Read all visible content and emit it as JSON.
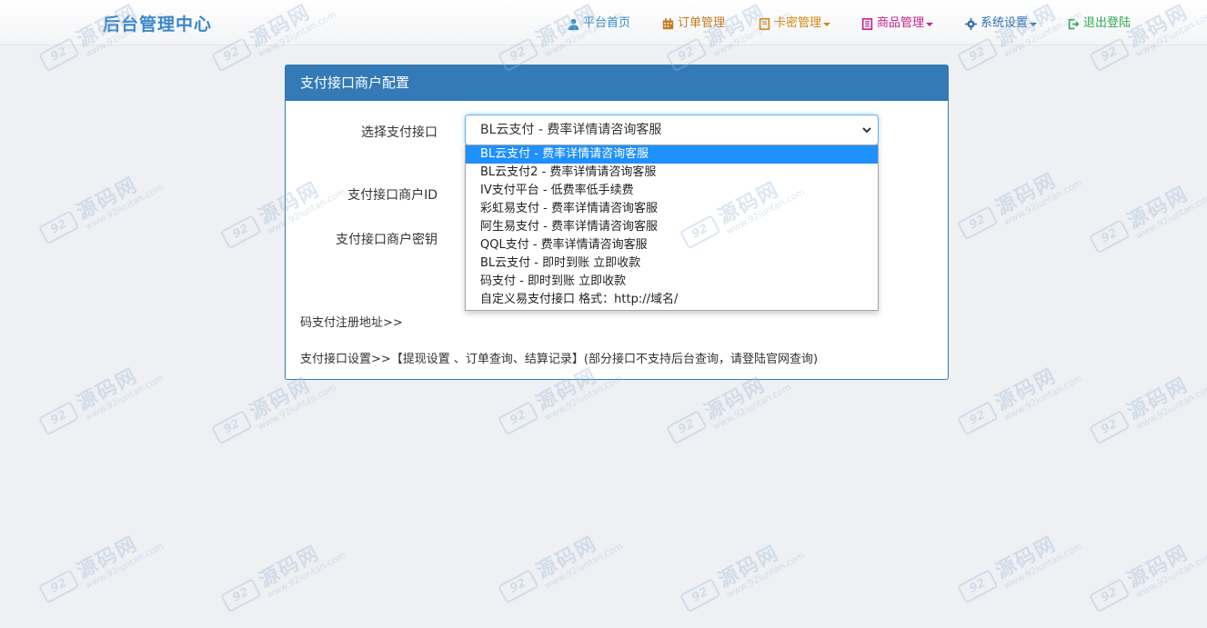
{
  "header": {
    "brand": "后台管理中心",
    "nav": [
      {
        "label": "平台首页",
        "icon": "user-icon",
        "color": "#2f8bc9",
        "dropdown": false
      },
      {
        "label": "订单管理",
        "icon": "calendar-icon",
        "color": "#c57a1f",
        "dropdown": false
      },
      {
        "label": "卡密管理",
        "icon": "book-icon",
        "color": "#d58512",
        "dropdown": true
      },
      {
        "label": "商品管理",
        "icon": "list-icon",
        "color": "#c7218f",
        "dropdown": true
      },
      {
        "label": "系统设置",
        "icon": "gear-icon",
        "color": "#2c6fae",
        "dropdown": true
      },
      {
        "label": "退出登陆",
        "icon": "logout-icon",
        "color": "#35a855",
        "dropdown": false
      }
    ]
  },
  "panel": {
    "title": "支付接口商户配置",
    "select_label": "选择支付接口",
    "selected_value": "BL云支付 - 费率详情请咨询客服",
    "merchant_id_label": "支付接口商户ID",
    "merchant_key_label": "支付接口商户密钥",
    "register_link": "码支付注册地址>>",
    "settings_text": "支付接口设置>>【提现设置 、订单查询、结算记录】(部分接口不支持后台查询，请登陆官网查询)"
  },
  "dropdown": {
    "options": [
      "BL云支付 - 费率详情请咨询客服",
      "BL云支付2 - 费率详情请咨询客服",
      "IV支付平台 - 低费率低手续费",
      "彩虹易支付 - 费率详情请咨询客服",
      "阿生易支付 - 费率详情请咨询客服",
      "QQL支付 - 费率详情请咨询客服",
      "BL云支付 - 即时到账 立即收款",
      "码支付 - 即时到账 立即收款",
      "自定义易支付接口 格式：http://域名/"
    ],
    "selected_index": 0
  },
  "watermark": {
    "logo": "92",
    "text": "源码网",
    "url": "www.92iuntan.com"
  },
  "colors": {
    "accent": "#337ab7",
    "selected_option": "#1e90ff",
    "brand": "#3a86c8"
  }
}
